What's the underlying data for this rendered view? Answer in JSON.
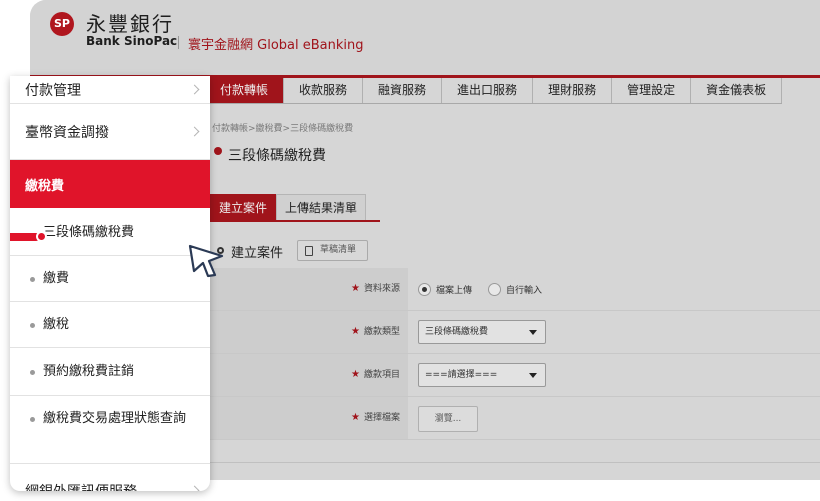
{
  "header": {
    "logo_mark": "SP",
    "brand_cn": "永豐銀行",
    "brand_en": "Bank SinoPac",
    "subtitle": "寰宇金融網 Global eBanking"
  },
  "nav": {
    "tabs": [
      {
        "label": "付款轉帳",
        "active": true
      },
      {
        "label": "收款服務",
        "active": false
      },
      {
        "label": "融資服務",
        "active": false
      },
      {
        "label": "進出口服務",
        "active": false
      },
      {
        "label": "理財服務",
        "active": false
      },
      {
        "label": "管理設定",
        "active": false
      },
      {
        "label": "資金儀表板",
        "active": false
      }
    ]
  },
  "breadcrumb": "付款轉帳>繳稅費>三段條碼繳稅費",
  "page_title": "三段條碼繳稅費",
  "subtabs": [
    {
      "label": "建立案件",
      "active": true
    },
    {
      "label": "上傳結果清單",
      "active": false
    }
  ],
  "section": {
    "title": "建立案件",
    "draft_button": "草稿清單"
  },
  "form": {
    "source_label": "資料來源",
    "source_options": [
      {
        "label": "檔案上傳",
        "selected": true
      },
      {
        "label": "自行輸入",
        "selected": false
      }
    ],
    "type_label": "繳款類型",
    "type_value": "三段條碼繳稅費",
    "item_label": "繳款項目",
    "item_value": "===請選擇===",
    "file_label": "選擇檔案",
    "browse_button": "瀏覽..."
  },
  "menu": {
    "items": [
      {
        "label": "付款管理",
        "chevron": true
      },
      {
        "label": "臺幣資金調撥",
        "chevron": true
      },
      {
        "label": "繳稅費",
        "active": true
      },
      {
        "label": "三段條碼繳稅費",
        "current": true
      },
      {
        "label": "繳費"
      },
      {
        "label": "繳稅"
      },
      {
        "label": "預約繳稅費註銷"
      },
      {
        "label": "繳稅費交易處理狀態查詢"
      },
      {
        "label": "網銀外匯訊便服務",
        "chevron": true
      }
    ]
  },
  "colors": {
    "brand_red": "#a0141b",
    "menu_red": "#e0142a"
  }
}
